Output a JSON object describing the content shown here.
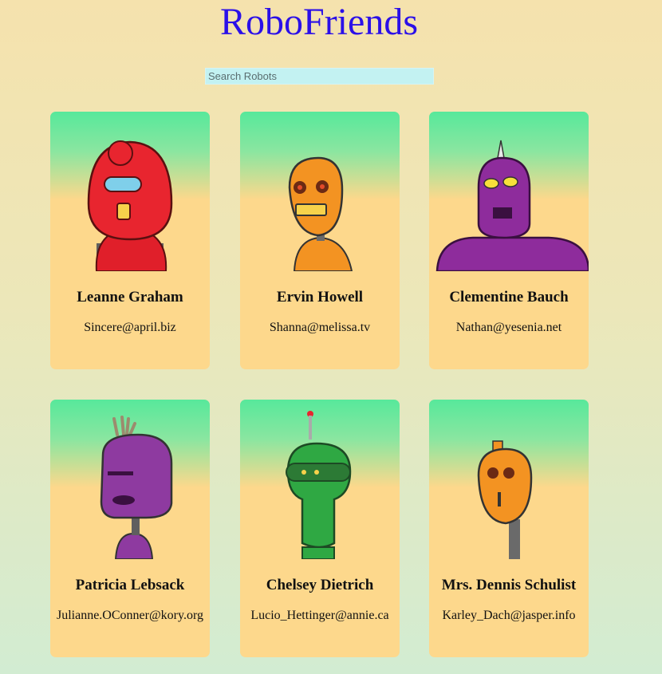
{
  "app": {
    "title": "RoboFriends"
  },
  "search": {
    "placeholder": "Search Robots",
    "value": ""
  },
  "robots": [
    {
      "name": "Leanne Graham",
      "email": "Sincere@april.biz",
      "color": "#e8252f"
    },
    {
      "name": "Ervin Howell",
      "email": "Shanna@melissa.tv",
      "color": "#f39322"
    },
    {
      "name": "Clementine Bauch",
      "email": "Nathan@yesenia.net",
      "color": "#8e2c9c"
    },
    {
      "name": "Patricia Lebsack",
      "email": "Julianne.OConner@kory.org",
      "color": "#8e3aa0"
    },
    {
      "name": "Chelsey Dietrich",
      "email": "Lucio_Hettinger@annie.ca",
      "color": "#2fa843"
    },
    {
      "name": "Mrs. Dennis Schulist",
      "email": "Karley_Dach@jasper.info",
      "color": "#f39322"
    }
  ]
}
